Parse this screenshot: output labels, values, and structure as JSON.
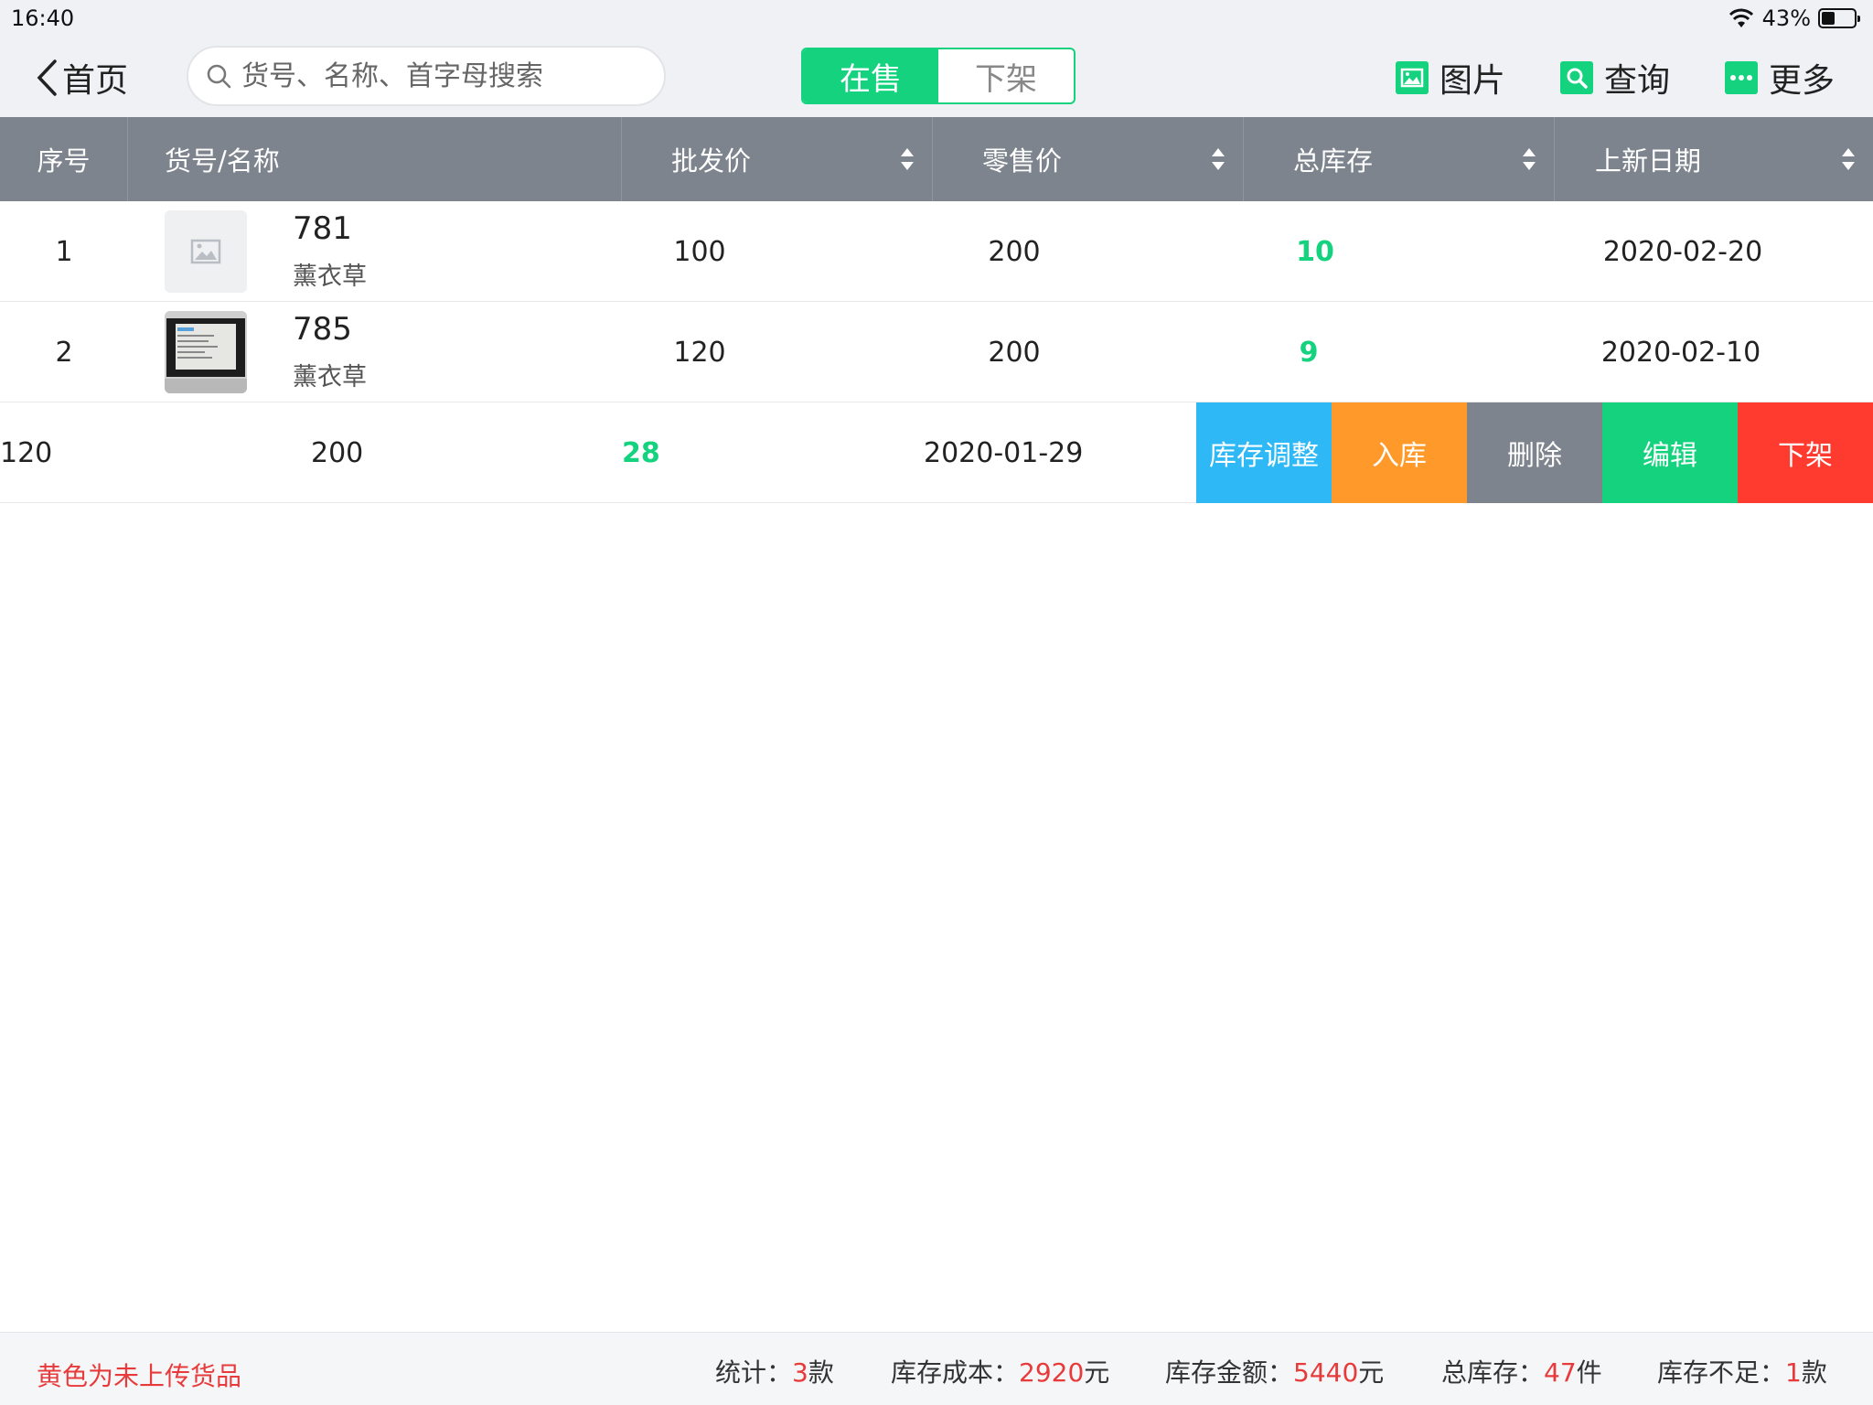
{
  "status_bar": {
    "time": "16:40",
    "battery": "43%",
    "battery_level": 0.43
  },
  "nav": {
    "back_label": "首页",
    "search_placeholder": "货号、名称、首字母搜索",
    "segments": [
      "在售",
      "下架"
    ],
    "active_segment": "在售",
    "tools": [
      {
        "label": "图片",
        "icon": "image-icon"
      },
      {
        "label": "查询",
        "icon": "search-icon"
      },
      {
        "label": "更多",
        "icon": "more-icon"
      }
    ]
  },
  "table": {
    "headers": [
      "序号",
      "货号/名称",
      "批发价",
      "零售价",
      "总库存",
      "上新日期"
    ],
    "rows": [
      {
        "index": "1",
        "code": "781",
        "name": "薰衣草",
        "wholesale": "100",
        "retail": "200",
        "stock": "10",
        "date": "2020-02-20"
      },
      {
        "index": "2",
        "code": "785",
        "name": "薰衣草",
        "wholesale": "120",
        "retail": "200",
        "stock": "9",
        "date": "2020-02-10"
      },
      {
        "wholesale": "120",
        "retail": "200",
        "stock": "28",
        "date": "2020-01-29"
      }
    ],
    "actions": [
      {
        "label": "库存调整",
        "color": "#2eb8f5"
      },
      {
        "label": "入库",
        "color": "#ff9a2a"
      },
      {
        "label": "删除",
        "color": "#7d848d"
      },
      {
        "label": "编辑",
        "color": "#14d27d"
      },
      {
        "label": "下架",
        "color": "#ff3b30"
      }
    ]
  },
  "footer": {
    "note": "黄色为未上传货品",
    "stats": [
      {
        "label": "统计：",
        "value": "3",
        "unit": "款"
      },
      {
        "label": "库存成本：",
        "value": "2920",
        "unit": "元"
      },
      {
        "label": "库存金额：",
        "value": "5440",
        "unit": "元"
      },
      {
        "label": "总库存：",
        "value": "47",
        "unit": "件"
      },
      {
        "label": "库存不足：",
        "value": "1",
        "unit": "款"
      }
    ]
  },
  "colors": {
    "accent": "#14d27d",
    "header_bg": "#7d848d",
    "alert": "#e83a3a"
  }
}
